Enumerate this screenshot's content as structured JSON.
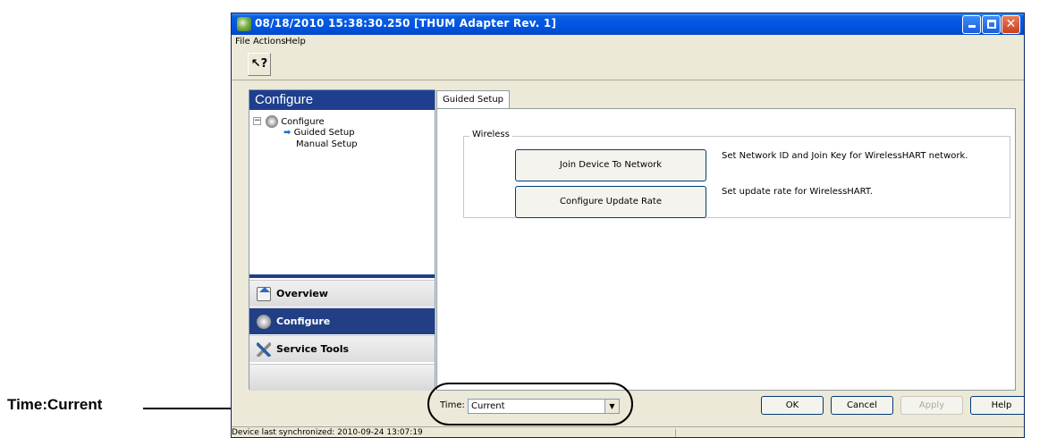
{
  "window": {
    "title": "08/18/2010 15:38:30.250 [THUM Adapter Rev. 1]",
    "controls": {
      "minimize": "minimize",
      "maximize": "maximize",
      "close": "✕"
    }
  },
  "menu": [
    "File",
    "Actions",
    "Help"
  ],
  "toolbar": {
    "help_cursor_glyph": "?"
  },
  "left_pane": {
    "header": "Configure",
    "tree": [
      {
        "label": "Configure",
        "expander": "−"
      },
      {
        "label": "Guided Setup"
      },
      {
        "label": "Manual Setup"
      }
    ],
    "nav": [
      {
        "label": "Overview",
        "icon": "house-icon"
      },
      {
        "label": "Configure",
        "icon": "gear-icon",
        "selected": true
      },
      {
        "label": "Service Tools",
        "icon": "tools-icon"
      }
    ]
  },
  "tabs": [
    "Guided Setup"
  ],
  "guided_setup": {
    "group_label": "Wireless",
    "actions": [
      {
        "label": "Join Device To Network",
        "description": "Set Network ID and Join Key for WirelessHART network."
      },
      {
        "label": "Configure Update Rate",
        "description": "Set update rate for WirelessHART."
      }
    ]
  },
  "time": {
    "label": "Time:",
    "value": "Current"
  },
  "buttons": {
    "ok": "OK",
    "cancel": "Cancel",
    "apply": "Apply",
    "help": "Help"
  },
  "status": {
    "text": "Device last synchronized: 2010-09-24 13:07:19"
  },
  "callout": {
    "label": "Time:Current"
  },
  "colors": {
    "title_blue": "#0054e3",
    "nav_selected": "#223f86",
    "window_bg": "#ece9d8"
  }
}
